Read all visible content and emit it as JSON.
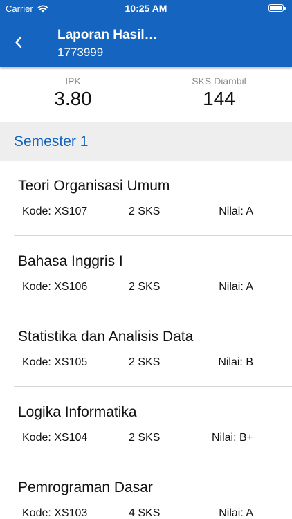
{
  "status_bar": {
    "carrier": "Carrier",
    "time": "10:25 AM",
    "icons": [
      "wifi-icon",
      "battery-icon"
    ]
  },
  "header": {
    "title": "Laporan Hasil…",
    "subtitle": "1773999",
    "background_color": "#1565c0"
  },
  "summary": {
    "ipk_label": "IPK",
    "ipk_value": "3.80",
    "sks_label": "SKS Diambil",
    "sks_value": "144"
  },
  "section": {
    "title": "Semester 1",
    "accent_color": "#1565c0"
  },
  "courses": [
    {
      "name": "Teori Organisasi Umum",
      "code": "Kode: XS107",
      "sks": "2 SKS",
      "grade": "Nilai: A"
    },
    {
      "name": "Bahasa Inggris I",
      "code": "Kode: XS106",
      "sks": "2 SKS",
      "grade": "Nilai: A"
    },
    {
      "name": "Statistika dan Analisis Data",
      "code": "Kode: XS105",
      "sks": "2 SKS",
      "grade": "Nilai: B"
    },
    {
      "name": "Logika Informatika",
      "code": "Kode: XS104",
      "sks": "2 SKS",
      "grade": "Nilai: B+"
    },
    {
      "name": "Pemrograman Dasar",
      "code": "Kode: XS103",
      "sks": "4 SKS",
      "grade": "Nilai: A"
    }
  ]
}
